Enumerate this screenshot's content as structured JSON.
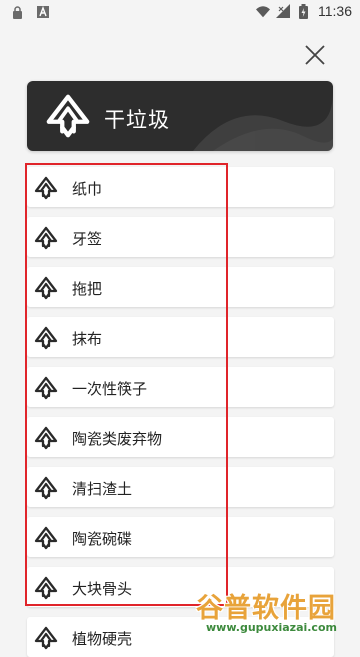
{
  "status_bar": {
    "time": "11:36",
    "left_icons": [
      "lock-icon",
      "text-a-icon"
    ],
    "right_icons": [
      "wifi-icon",
      "signal-icon",
      "battery-icon"
    ]
  },
  "close_icon": "close-icon",
  "header": {
    "title": "干垃圾",
    "background": "#2d2d2d",
    "icon": "dry-waste-icon"
  },
  "items": [
    {
      "label": "纸巾"
    },
    {
      "label": "牙签"
    },
    {
      "label": "拖把"
    },
    {
      "label": "抹布"
    },
    {
      "label": "一次性筷子"
    },
    {
      "label": "陶瓷类废弃物"
    },
    {
      "label": "清扫渣土"
    },
    {
      "label": "陶瓷碗碟"
    },
    {
      "label": "大块骨头"
    },
    {
      "label": "植物硬壳"
    }
  ],
  "highlight_color": "#e0242a",
  "watermark": {
    "main": "谷普软件园",
    "sub": "www.gupuxiazai.com"
  }
}
